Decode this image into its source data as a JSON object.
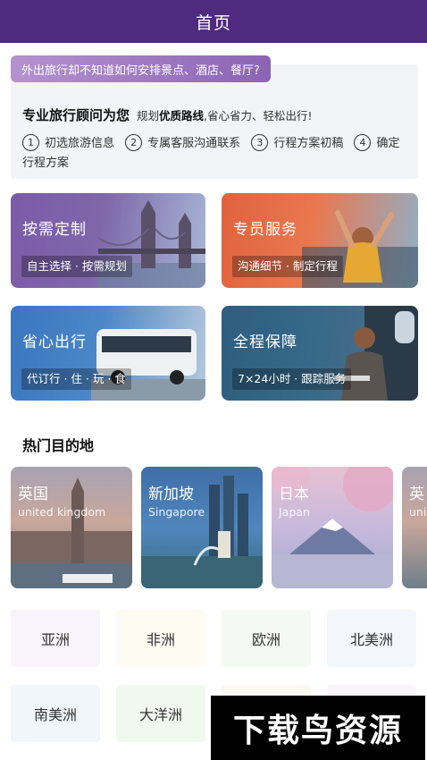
{
  "header": {
    "title": "首页"
  },
  "intro": {
    "banner": "外出旅行却不知道如何安排景点、酒店、餐厅?",
    "headline": "专业旅行顾问为您",
    "sub_prefix": "规划",
    "sub_bold": "优质路线",
    "sub_suffix": ",省心省力、轻松出行!",
    "steps": [
      {
        "num": "1",
        "label": "初选旅游信息"
      },
      {
        "num": "2",
        "label": "专属客服沟通联系"
      },
      {
        "num": "3",
        "label": "行程方案初稿"
      },
      {
        "num": "4",
        "label": "确定行程方案"
      }
    ]
  },
  "services": [
    {
      "title": "按需定制",
      "subtitle": "自主选择 · 按需规划"
    },
    {
      "title": "专员服务",
      "subtitle": "沟通细节 · 制定行程"
    },
    {
      "title": "省心出行",
      "subtitle": "代订行 · 住 · 玩 · 食"
    },
    {
      "title": "全程保障",
      "subtitle": "7×24小时 · 跟踪服务"
    }
  ],
  "destinations": {
    "title": "热门目的地",
    "items": [
      {
        "name": "英国",
        "en": "united kingdom"
      },
      {
        "name": "新加坡",
        "en": "Singapore"
      },
      {
        "name": "日本",
        "en": "Japan"
      },
      {
        "name": "英",
        "en": "uni"
      }
    ]
  },
  "regions": [
    {
      "label": "亚洲",
      "color": "#f7f5fb"
    },
    {
      "label": "非洲",
      "color": "#fdfbf2"
    },
    {
      "label": "欧洲",
      "color": "#f5f9f3"
    },
    {
      "label": "北美洲",
      "color": "#f3f6fb"
    },
    {
      "label": "南美洲",
      "color": "#f1f6fb"
    },
    {
      "label": "大洋洲",
      "color": "#f1f8ef"
    },
    {
      "label": "",
      "color": "#fdf8ef"
    },
    {
      "label": "",
      "color": "#f8f5fb"
    }
  ],
  "watermark": {
    "text": "下载鸟资源"
  }
}
